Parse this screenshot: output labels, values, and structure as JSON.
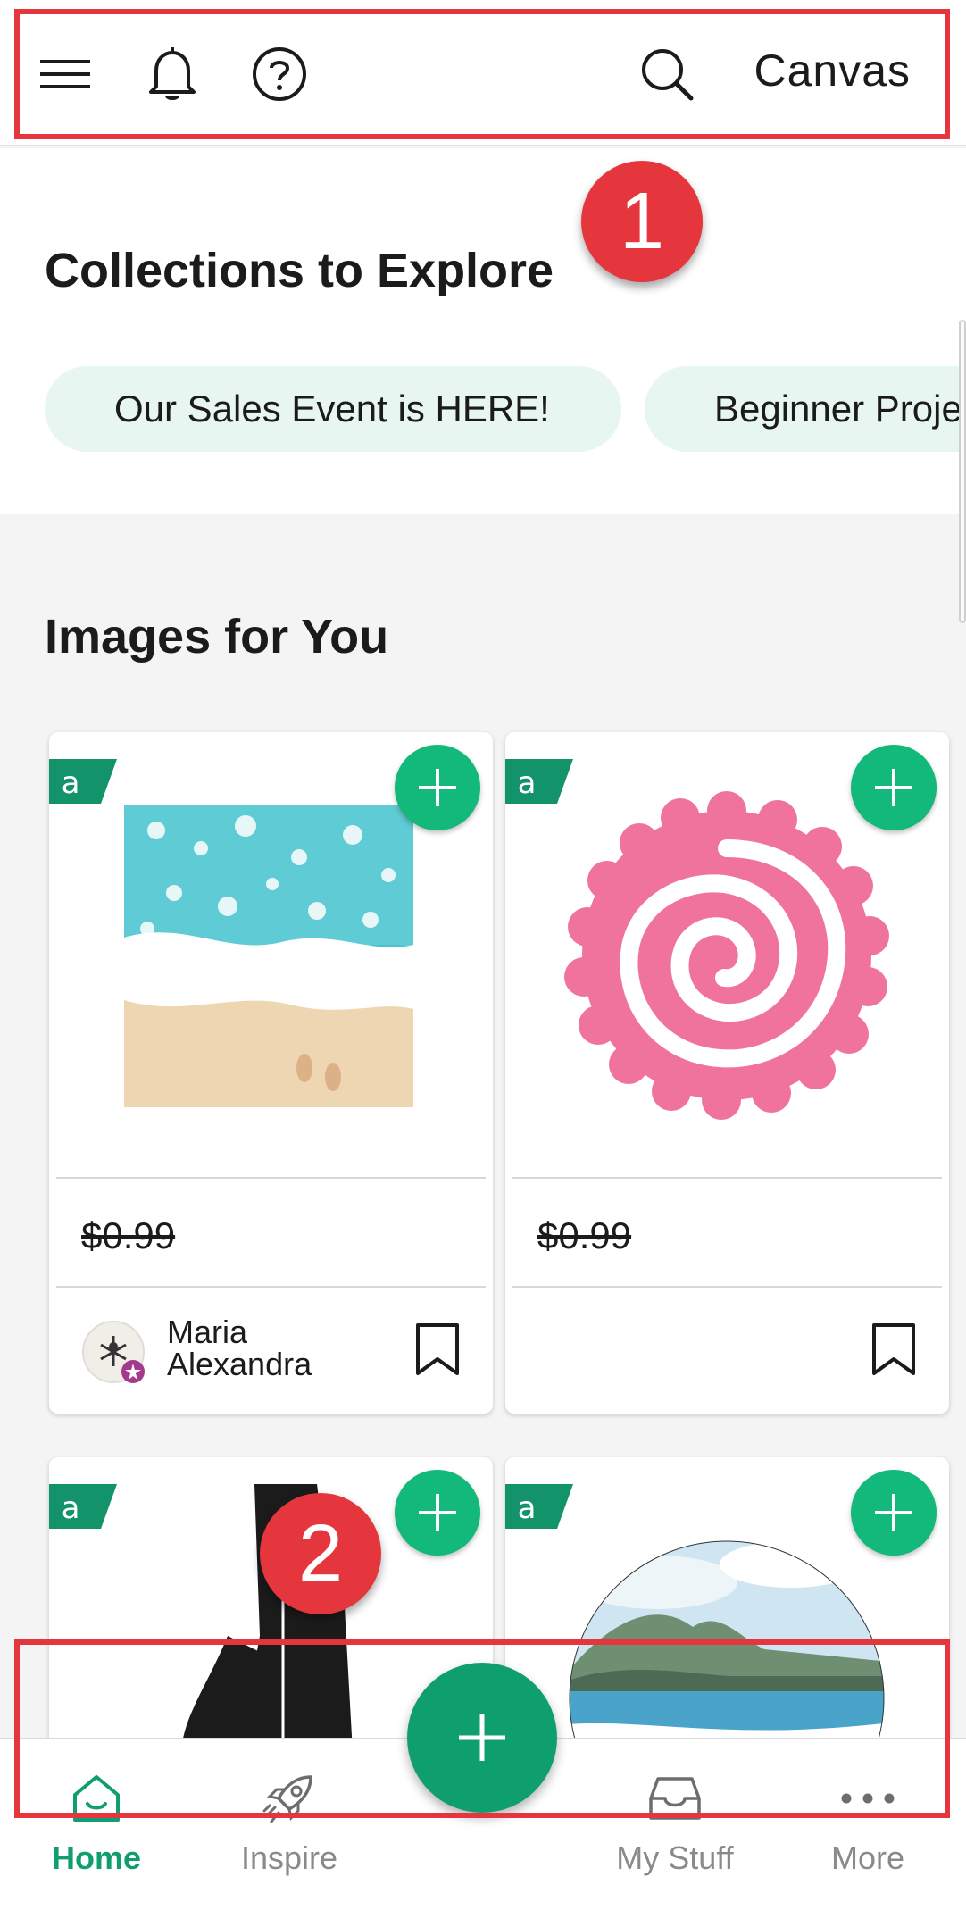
{
  "header": {
    "menu_icon": "hamburger-menu-icon",
    "notifications_icon": "bell-icon",
    "help_icon": "question-circle-icon",
    "search_icon": "search-icon",
    "canvas_label": "Canvas"
  },
  "collections": {
    "title": "Collections to Explore",
    "pills": [
      {
        "label": "Our Sales Event is HERE!"
      },
      {
        "label": "Beginner Proje"
      }
    ]
  },
  "images_for_you": {
    "title": "Images for You",
    "cards": [
      {
        "image": "beach-waves-footprints-image",
        "price": "$0.99",
        "author": "Maria Alexandra",
        "badge": "access-tag-icon"
      },
      {
        "image": "pink-rolled-flower-spiral-image",
        "price": "$0.99",
        "author": "",
        "badge": "access-tag-icon"
      },
      {
        "image": "couple-silhouette-image",
        "badge": "access-tag-icon"
      },
      {
        "image": "watercolor-beach-landscape-image",
        "badge": "access-tag-icon"
      }
    ]
  },
  "annotations": [
    {
      "number": "1"
    },
    {
      "number": "2"
    }
  ],
  "bottom_nav": {
    "items": [
      {
        "label": "Home",
        "icon": "home-icon",
        "active": true
      },
      {
        "label": "Inspire",
        "icon": "rocket-icon",
        "active": false
      },
      {
        "label": "My Stuff",
        "icon": "inbox-tray-icon",
        "active": false
      },
      {
        "label": "More",
        "icon": "more-dots-icon",
        "active": false
      }
    ],
    "fab_icon": "plus-icon"
  },
  "colors": {
    "brand_green": "#12b97b",
    "active_green": "#0f9f6e",
    "pill_background": "#e7f6f0",
    "annotation_red": "#e5363d",
    "spiral_pink": "#f0739e"
  }
}
